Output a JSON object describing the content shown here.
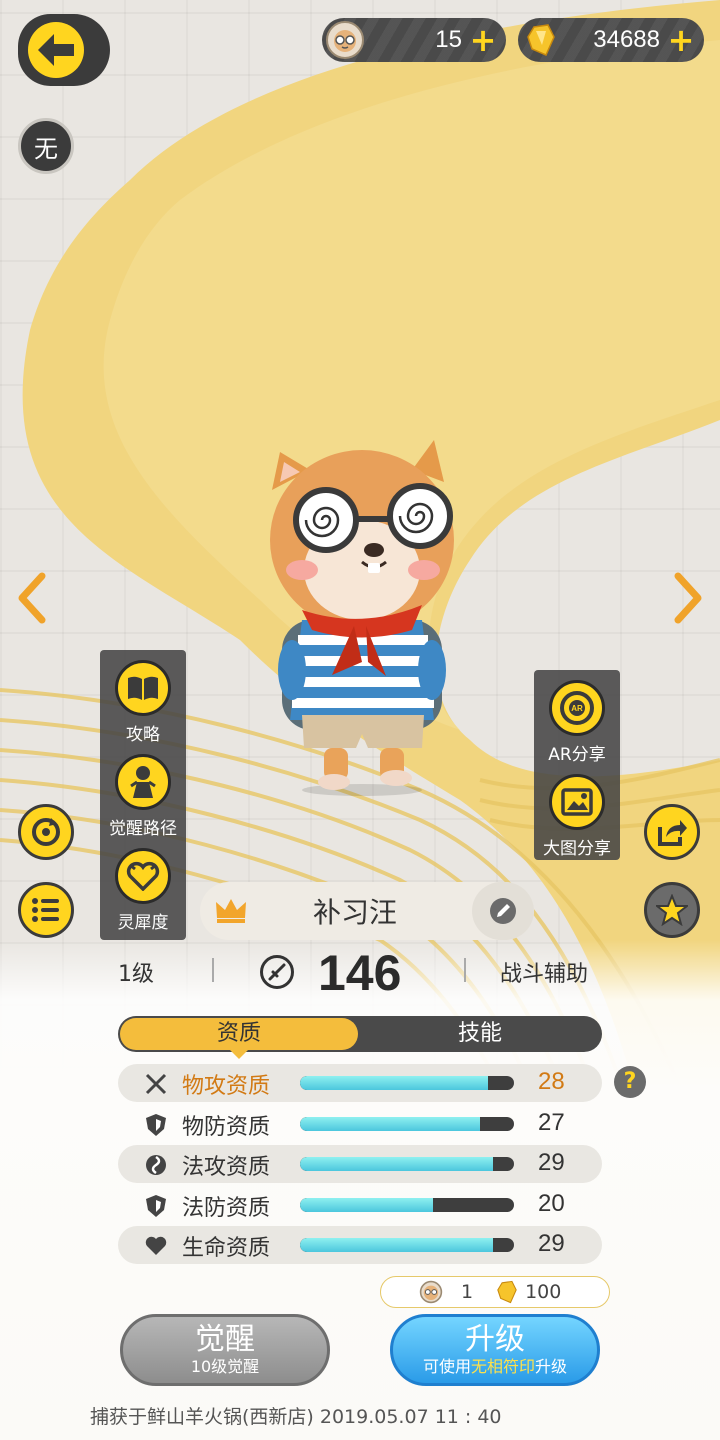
{
  "currency": {
    "tickets": "15",
    "crystals": "34688",
    "plus": "+"
  },
  "badge_label": "无",
  "left_menu": [
    {
      "label": "攻略",
      "icon": "book-icon"
    },
    {
      "label": "觉醒路径",
      "icon": "awaken-path-icon"
    },
    {
      "label": "灵犀度",
      "icon": "heart-icon"
    }
  ],
  "right_menu": [
    {
      "label": "AR分享",
      "icon": "ar-camera-icon",
      "icon_text": "AR"
    },
    {
      "label": "大图分享",
      "icon": "picture-icon"
    }
  ],
  "character": {
    "name": "补习汪",
    "level": "1级",
    "power": "146",
    "role": "战斗辅助"
  },
  "tabs": {
    "active": "资质",
    "inactive": "技能"
  },
  "attributes": [
    {
      "label": "物攻资质",
      "value": "28",
      "fill": 0.88
    },
    {
      "label": "物防资质",
      "value": "27",
      "fill": 0.84
    },
    {
      "label": "法攻资质",
      "value": "29",
      "fill": 0.9
    },
    {
      "label": "法防资质",
      "value": "20",
      "fill": 0.62
    },
    {
      "label": "生命资质",
      "value": "29",
      "fill": 0.9
    }
  ],
  "help_label": "?",
  "cost": {
    "tickets": "1",
    "crystals": "100"
  },
  "actions": {
    "awaken_label": "觉醒",
    "awaken_sub": "10级觉醒",
    "upgrade_label": "升级",
    "upgrade_sub_pre": "可使用",
    "upgrade_sub_hl": "无相符印",
    "upgrade_sub_post": "升级"
  },
  "footer": "捕获于鲜山羊火锅(西新店)   2019.05.07    11 : 40",
  "colors": {
    "accent_yellow": "#ffd51f",
    "tab_gold": "#f4bd3c",
    "upgrade_blue": "#2a9be8",
    "highlight_orange": "#d27a14",
    "bar_cyan": "#4cc6dd"
  }
}
